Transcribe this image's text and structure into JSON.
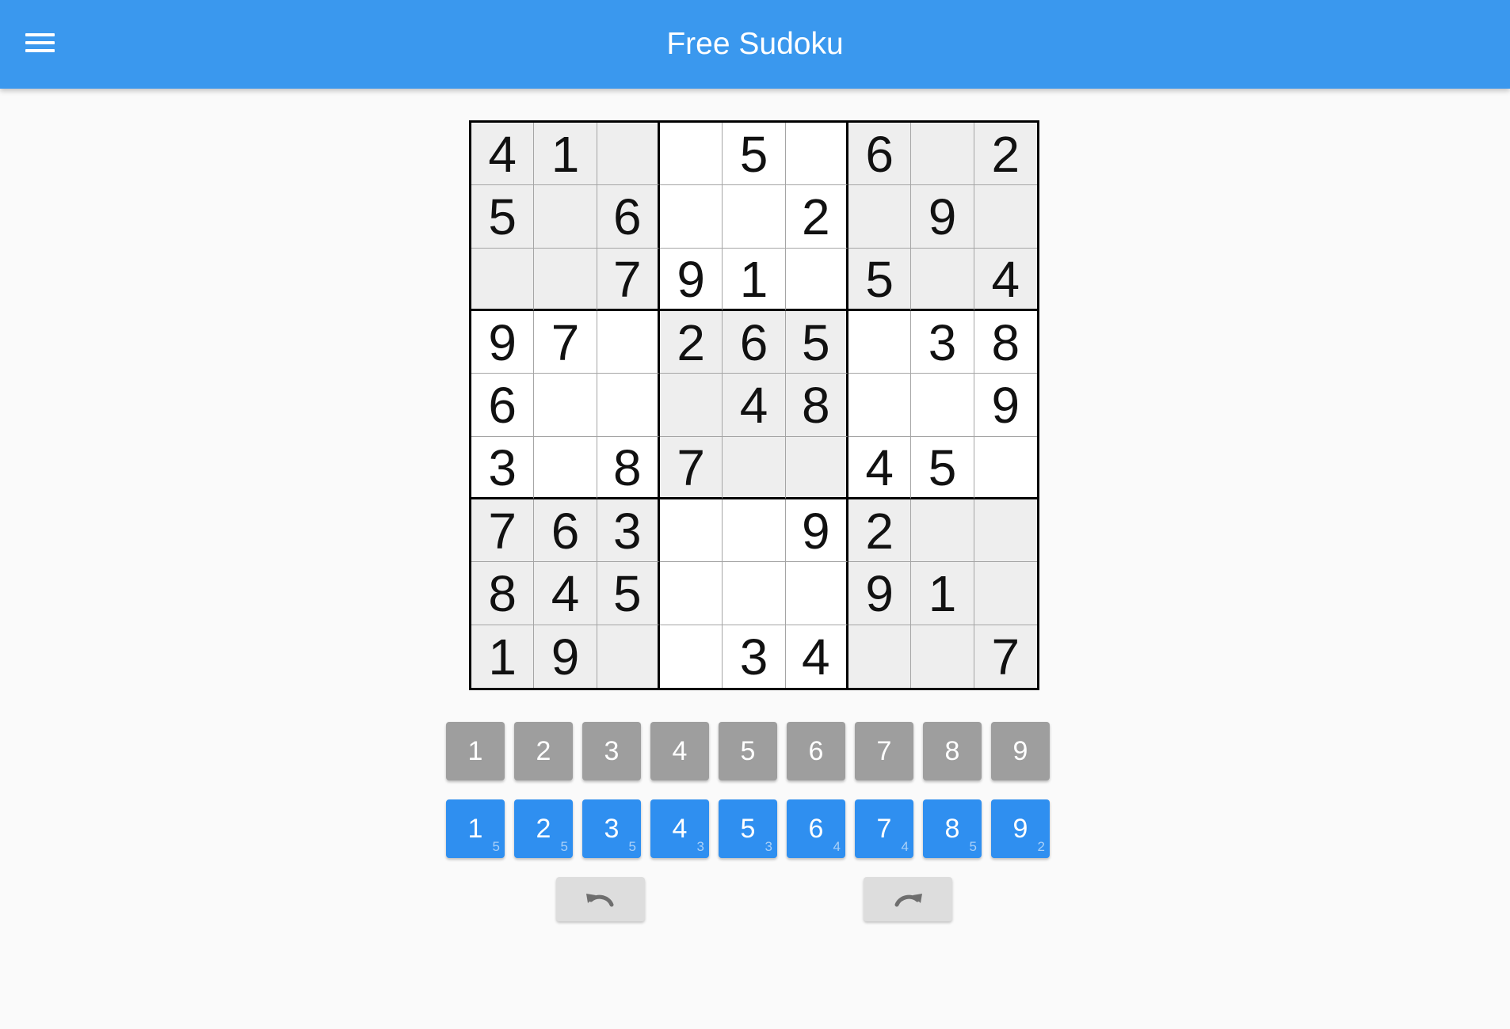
{
  "header": {
    "title": "Free Sudoku",
    "menu_icon": "hamburger-menu-icon"
  },
  "board": {
    "grid": [
      [
        "4",
        "1",
        "",
        "",
        "5",
        "",
        "6",
        "",
        "2"
      ],
      [
        "5",
        "",
        "6",
        "",
        "",
        "2",
        "",
        "9",
        ""
      ],
      [
        "",
        "",
        "7",
        "9",
        "1",
        "",
        "5",
        "",
        "4"
      ],
      [
        "9",
        "7",
        "",
        "2",
        "6",
        "5",
        "",
        "3",
        "8"
      ],
      [
        "6",
        "",
        "",
        "",
        "4",
        "8",
        "",
        "",
        "9"
      ],
      [
        "3",
        "",
        "8",
        "7",
        "",
        "",
        "4",
        "5",
        ""
      ],
      [
        "7",
        "6",
        "3",
        "",
        "",
        "9",
        "2",
        "",
        ""
      ],
      [
        "8",
        "4",
        "5",
        "",
        "",
        "",
        "9",
        "1",
        ""
      ],
      [
        "1",
        "9",
        "",
        "",
        "3",
        "4",
        "",
        "",
        "7"
      ]
    ],
    "shaded_boxes": [
      0,
      2,
      4,
      6,
      8
    ]
  },
  "note_pad": {
    "buttons": [
      "1",
      "2",
      "3",
      "4",
      "5",
      "6",
      "7",
      "8",
      "9"
    ]
  },
  "number_pad": {
    "buttons": [
      {
        "label": "1",
        "remaining": "5"
      },
      {
        "label": "2",
        "remaining": "5"
      },
      {
        "label": "3",
        "remaining": "5"
      },
      {
        "label": "4",
        "remaining": "3"
      },
      {
        "label": "5",
        "remaining": "3"
      },
      {
        "label": "6",
        "remaining": "4"
      },
      {
        "label": "7",
        "remaining": "4"
      },
      {
        "label": "8",
        "remaining": "5"
      },
      {
        "label": "9",
        "remaining": "2"
      }
    ]
  },
  "actions": {
    "undo_icon": "undo-icon",
    "redo_icon": "redo-icon"
  },
  "colors": {
    "app_bar": "#3a98ee",
    "number_button": "#2f8ff0",
    "note_button": "#9e9e9e",
    "shaded_cell": "#eeeeee",
    "action_button": "#dddddd"
  }
}
